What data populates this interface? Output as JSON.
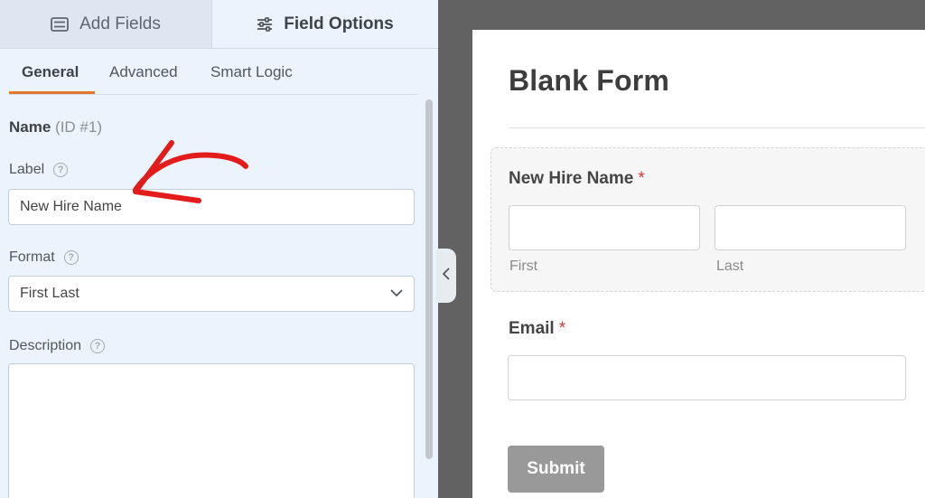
{
  "sidebar": {
    "tabs": {
      "add_fields": "Add Fields",
      "field_options": "Field Options"
    },
    "subtabs": {
      "general": "General",
      "advanced": "Advanced",
      "smart_logic": "Smart Logic"
    },
    "field_name": "Name",
    "field_id": "(ID #1)",
    "label_title": "Label",
    "label_value": "New Hire Name",
    "format_title": "Format",
    "format_value": "First Last",
    "description_title": "Description",
    "help_glyph": "?"
  },
  "preview": {
    "form_title": "Blank Form",
    "name_field_label": "New Hire Name",
    "required_marker": "*",
    "first_sublabel": "First",
    "last_sublabel": "Last",
    "email_field_label": "Email",
    "submit_label": "Submit"
  },
  "colors": {
    "accent": "#e27730",
    "arrow": "#e21b1b",
    "required": "#d63638",
    "submit": "#999999"
  }
}
